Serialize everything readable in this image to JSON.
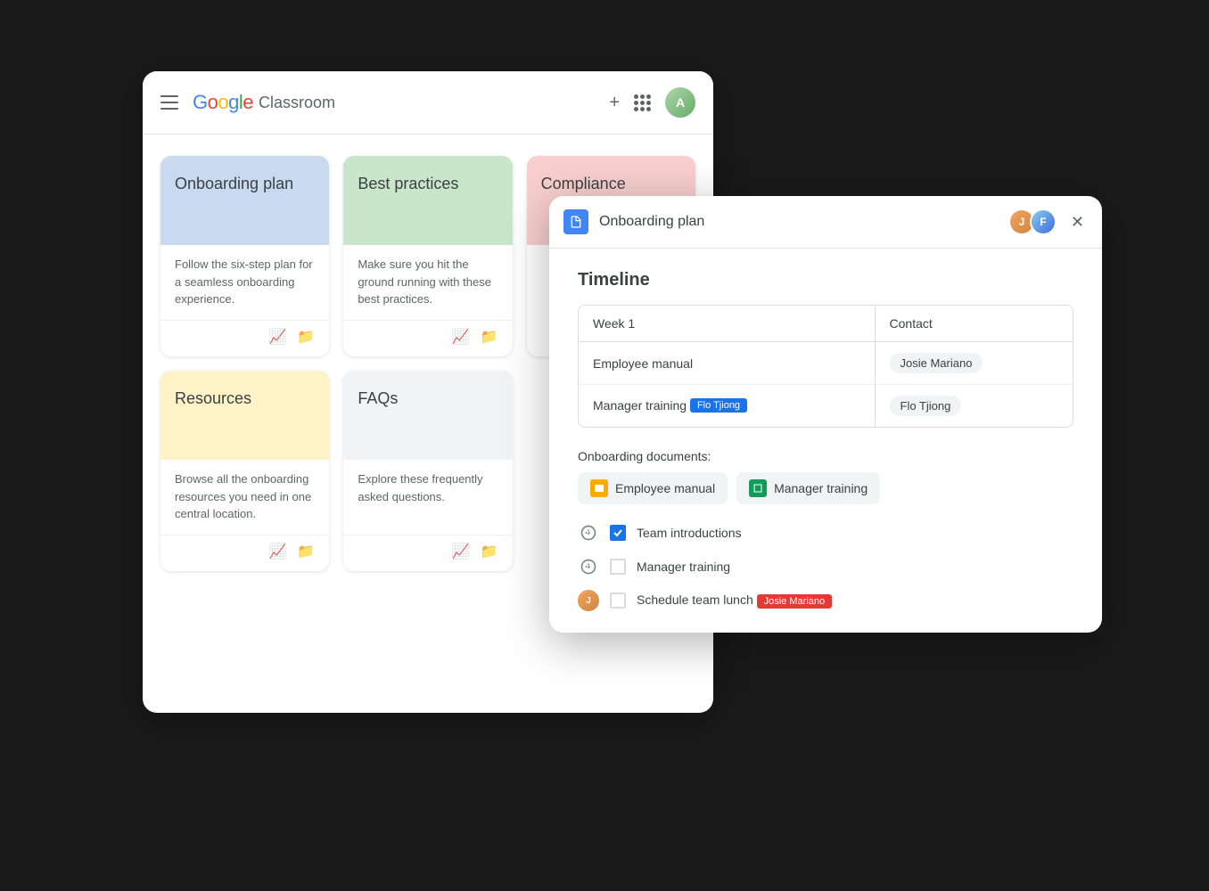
{
  "app": {
    "name": "Classroom",
    "google_label": "Google"
  },
  "header": {
    "add_label": "+",
    "avatar_initials": "A"
  },
  "cards": [
    {
      "id": "onboarding",
      "title": "Onboarding plan",
      "description": "Follow the six-step plan for a seamless onboarding experience.",
      "color": "blue"
    },
    {
      "id": "best-practices",
      "title": "Best practices",
      "description": "Make sure you hit the ground running with these best practices.",
      "color": "green"
    },
    {
      "id": "compliance",
      "title": "Compliance",
      "description": "",
      "color": "pink"
    },
    {
      "id": "resources",
      "title": "Resources",
      "description": "Browse all the onboarding resources you need in one central location.",
      "color": "yellow"
    },
    {
      "id": "faqs",
      "title": "FAQs",
      "description": "Explore these frequently asked questions.",
      "color": "gray"
    }
  ],
  "doc_panel": {
    "title": "Onboarding plan",
    "section": "Timeline",
    "table": {
      "headers": [
        "Week 1",
        "Contact"
      ],
      "rows": [
        {
          "week": "Employee manual",
          "contact": "Josie Mariano",
          "has_cursor": false,
          "cursor_label": ""
        },
        {
          "week": "Manager training",
          "contact": "Flo Tjiong",
          "has_cursor": true,
          "cursor_label": "Flo Tjiong"
        }
      ]
    },
    "onboarding_docs": {
      "label": "Onboarding documents:",
      "items": [
        {
          "name": "Employee manual",
          "icon_type": "yellow"
        },
        {
          "name": "Manager training",
          "icon_type": "green"
        }
      ]
    },
    "checklist": [
      {
        "text": "Team introductions",
        "checked": true,
        "has_avatar": false,
        "cursor_label": ""
      },
      {
        "text": "Manager training",
        "checked": false,
        "has_avatar": false,
        "cursor_label": ""
      },
      {
        "text": "Schedule team lunch",
        "checked": false,
        "has_avatar": true,
        "cursor_label": "Josie Mariano"
      }
    ]
  }
}
